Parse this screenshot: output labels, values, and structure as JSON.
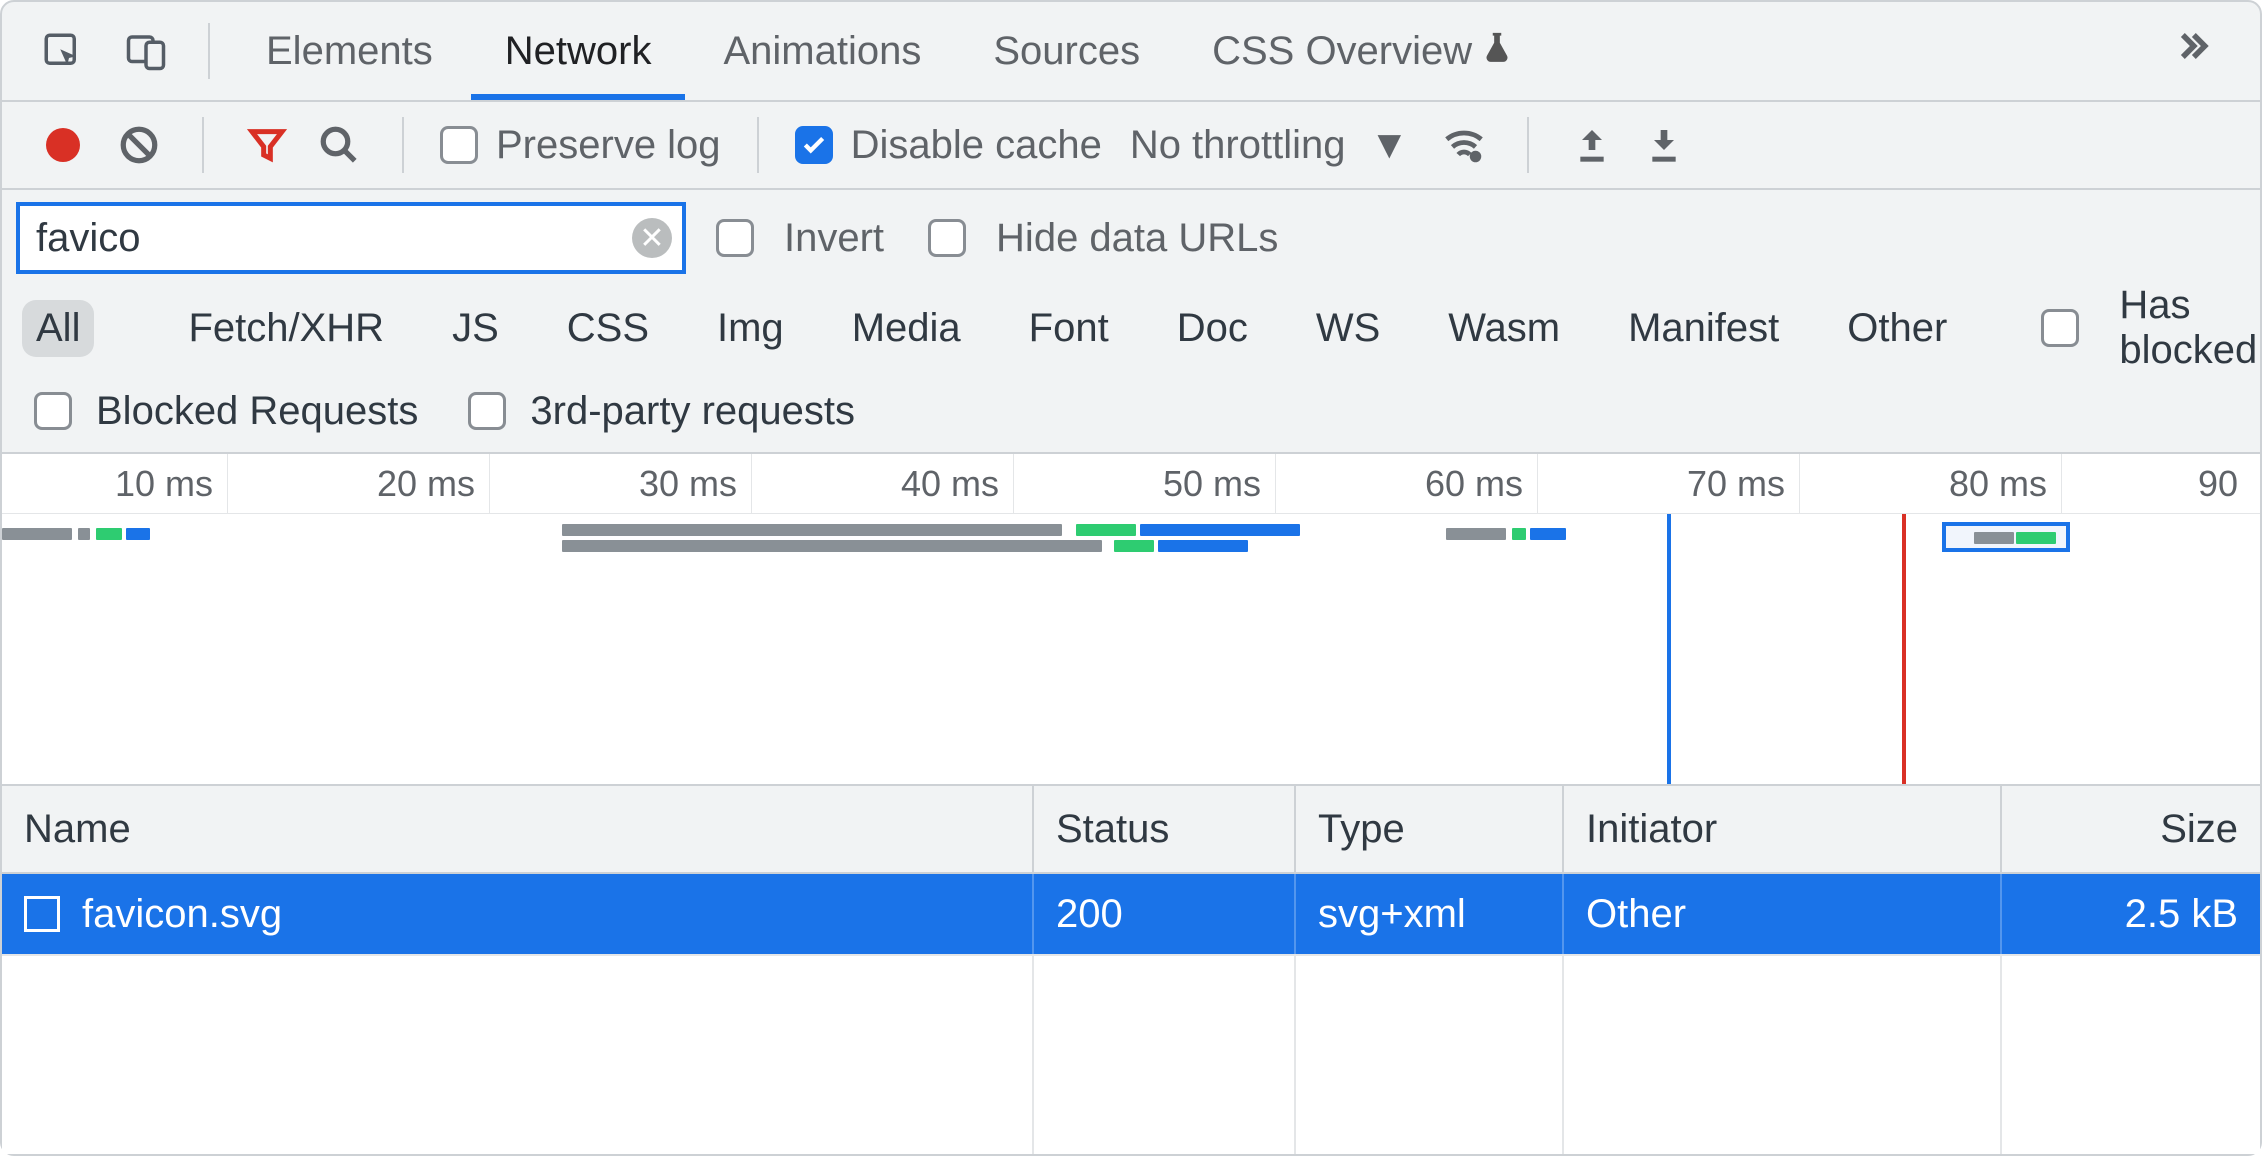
{
  "tabs": {
    "elements": "Elements",
    "network": "Network",
    "animations": "Animations",
    "sources": "Sources",
    "css_overview": "CSS Overview"
  },
  "toolbar": {
    "preserve_log": "Preserve log",
    "disable_cache": "Disable cache",
    "throttling": "No throttling"
  },
  "filter": {
    "value": "favico",
    "invert": "Invert",
    "hide_data_urls": "Hide data URLs"
  },
  "types": {
    "all": "All",
    "fetch": "Fetch/XHR",
    "js": "JS",
    "css": "CSS",
    "img": "Img",
    "media": "Media",
    "font": "Font",
    "doc": "Doc",
    "ws": "WS",
    "wasm": "Wasm",
    "manifest": "Manifest",
    "other": "Other",
    "has_blocked": "Has blocked"
  },
  "checks": {
    "blocked_requests": "Blocked Requests",
    "third_party": "3rd-party requests"
  },
  "overview_ticks": [
    "10 ms",
    "20 ms",
    "30 ms",
    "40 ms",
    "50 ms",
    "60 ms",
    "70 ms",
    "80 ms",
    "90 "
  ],
  "columns": {
    "name": "Name",
    "status": "Status",
    "type": "Type",
    "initiator": "Initiator",
    "size": "Size"
  },
  "row": {
    "name": "favicon.svg",
    "status": "200",
    "type": "svg+xml",
    "initiator": "Other",
    "size": "2.5 kB"
  }
}
